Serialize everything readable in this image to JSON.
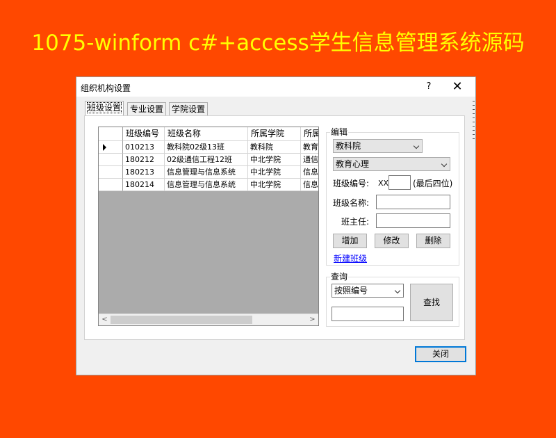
{
  "banner": "1075-winform c#+access学生信息管理系统源码",
  "window": {
    "title": "组织机构设置",
    "help": "?",
    "close": "✕"
  },
  "tabs": [
    {
      "label": "班级设置",
      "active": true
    },
    {
      "label": "专业设置",
      "active": false
    },
    {
      "label": "学院设置",
      "active": false
    }
  ],
  "grid": {
    "columns": [
      "班级编号",
      "班级名称",
      "所属学院",
      "所属"
    ],
    "rows": [
      [
        "010213",
        "教科院02级13班",
        "教科院",
        "教育"
      ],
      [
        "180212",
        "02级通信工程12班",
        "中北学院",
        "通信"
      ],
      [
        "180213",
        "信息管理与信息系统",
        "中北学院",
        "信息"
      ],
      [
        "180214",
        "信息管理与信息系统",
        "中北学院",
        "信息"
      ]
    ],
    "scroll_left": "<",
    "scroll_right": ">"
  },
  "edit": {
    "title": "编辑",
    "college": "教科院",
    "major": "教育心理",
    "class_no_label": "班级编号:",
    "class_no_prefix": "XX",
    "class_no_hint": "(最后四位)",
    "class_name_label": "班级名称:",
    "head_teacher_label": "班主任:",
    "add_label": "增加",
    "modify_label": "修改",
    "delete_label": "删除",
    "new_class_link": "新建班级"
  },
  "query": {
    "title": "查询",
    "mode": "按照编号",
    "search_label": "查找"
  },
  "close_label": "关闭"
}
